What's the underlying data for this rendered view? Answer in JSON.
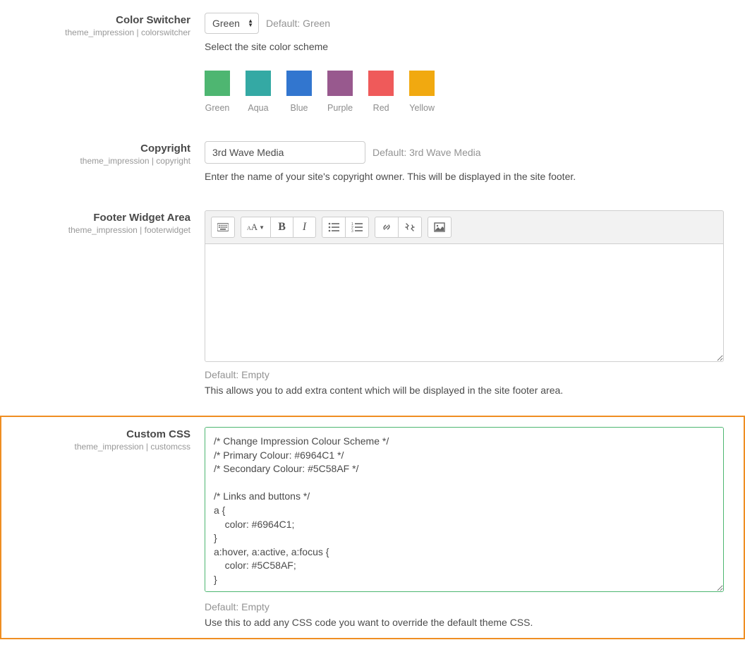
{
  "settings": {
    "colorSwitcher": {
      "label": "Color Switcher",
      "path": "theme_impression | colorswitcher",
      "value": "Green",
      "default": "Default: Green",
      "description": "Select the site color scheme",
      "swatches": [
        {
          "name": "Green",
          "color": "#4eb671"
        },
        {
          "name": "Aqua",
          "color": "#34a9a4"
        },
        {
          "name": "Blue",
          "color": "#3276cf"
        },
        {
          "name": "Purple",
          "color": "#98598e"
        },
        {
          "name": "Red",
          "color": "#ef5a5a"
        },
        {
          "name": "Yellow",
          "color": "#f1a910"
        }
      ]
    },
    "copyright": {
      "label": "Copyright",
      "path": "theme_impression | copyright",
      "value": "3rd Wave Media",
      "default": "Default: 3rd Wave Media",
      "description": "Enter the name of your site's copyright owner. This will be displayed in the site footer."
    },
    "footerWidget": {
      "label": "Footer Widget Area",
      "path": "theme_impression | footerwidget",
      "default": "Default: Empty",
      "description": "This allows you to add extra content which will be displayed in the site footer area."
    },
    "customCss": {
      "label": "Custom CSS",
      "path": "theme_impression | customcss",
      "value": "/* Change Impression Colour Scheme */\n/* Primary Colour: #6964C1 */\n/* Secondary Colour: #5C58AF */\n\n/* Links and buttons */\na {\n    color: #6964C1;\n}\na:hover, a:active, a:focus {\n    color: #5C58AF;\n}",
      "default": "Default: Empty",
      "description": "Use this to add any CSS code you want to override the default theme CSS."
    }
  }
}
